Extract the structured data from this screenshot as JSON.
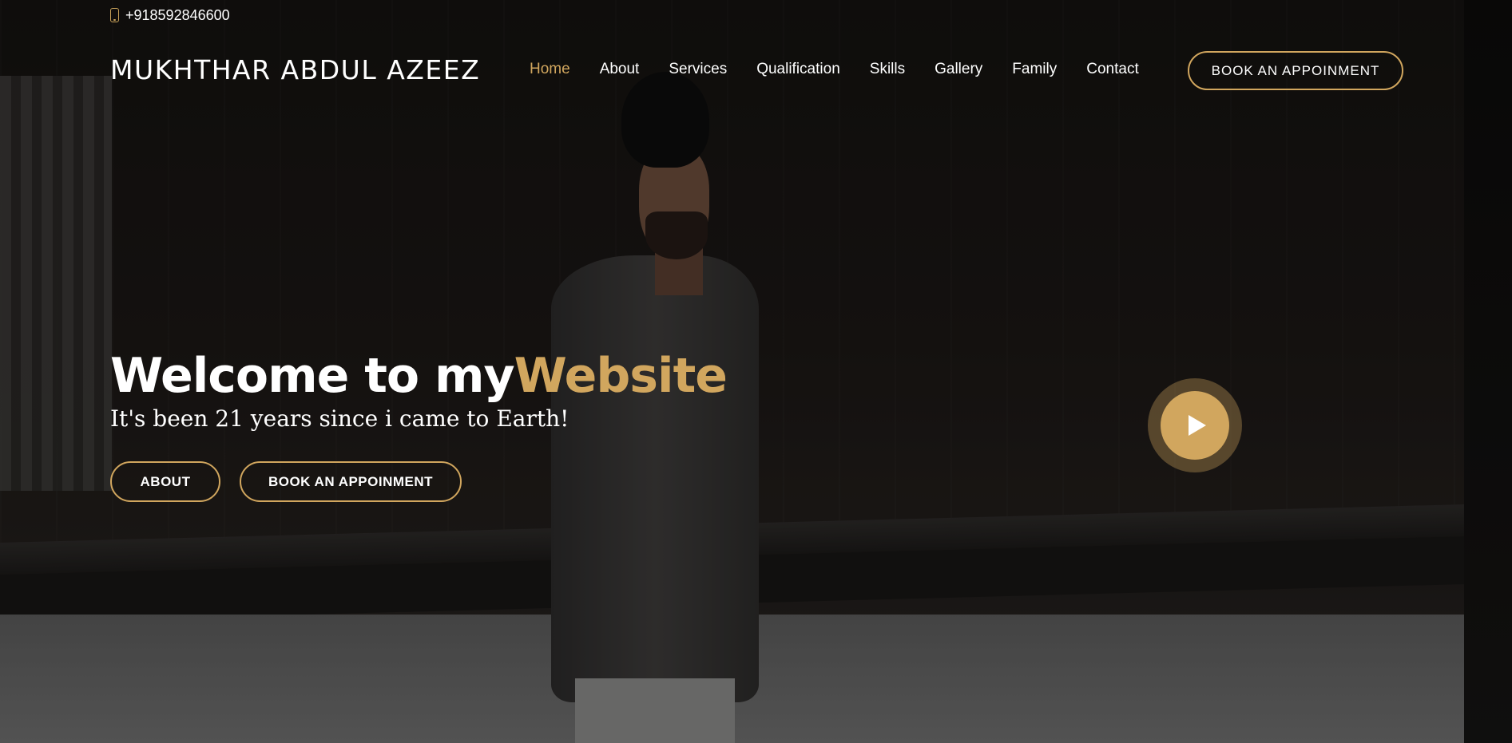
{
  "topbar": {
    "phone_icon": "phone-icon",
    "phone": "+918592846600"
  },
  "header": {
    "logo": "MUKHTHAR ABDUL AZEEZ",
    "nav": [
      {
        "label": "Home",
        "active": true
      },
      {
        "label": "About",
        "active": false
      },
      {
        "label": "Services",
        "active": false
      },
      {
        "label": "Qualification",
        "active": false
      },
      {
        "label": "Skills",
        "active": false
      },
      {
        "label": "Gallery",
        "active": false
      },
      {
        "label": "Family",
        "active": false
      },
      {
        "label": "Contact",
        "active": false
      }
    ],
    "cta_label": "BOOK AN APPOINMENT"
  },
  "hero": {
    "title_main": "Welcome to my",
    "title_accent": "Website",
    "subtitle": "It's been 21 years since i came to Earth!",
    "about_button": "ABOUT",
    "book_button": "BOOK AN APPOINMENT",
    "play_icon": "play-icon"
  },
  "colors": {
    "accent": "#d1a65e",
    "text": "#ffffff",
    "background": "#141110"
  }
}
